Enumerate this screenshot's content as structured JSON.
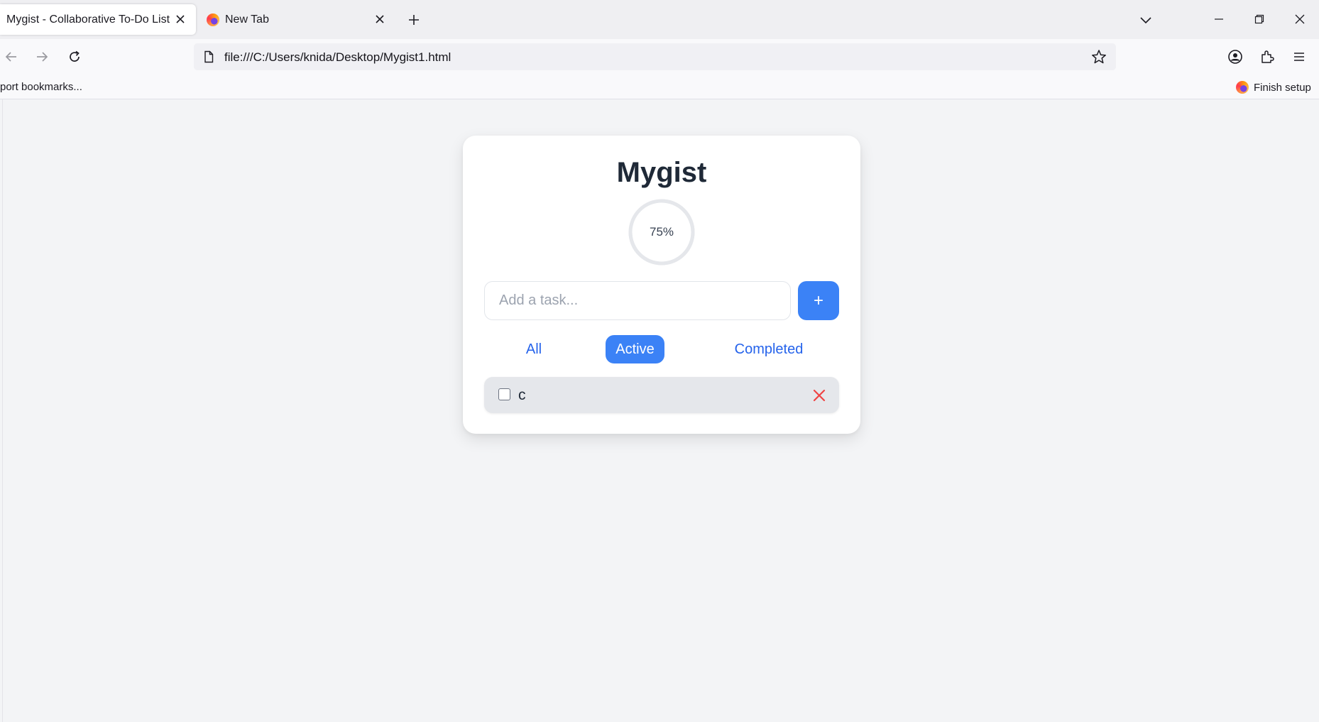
{
  "browser": {
    "tabs": [
      {
        "label": "Mygist - Collaborative To-Do List",
        "active": true,
        "icon": "page-icon"
      },
      {
        "label": "New Tab",
        "active": false,
        "icon": "firefox-icon"
      }
    ],
    "url": "file:///C:/Users/knida/Desktop/Mygist1.html",
    "bookmarks_left": "port bookmarks...",
    "bookmarks_right": "Finish setup"
  },
  "app": {
    "title": "Mygist",
    "progress": {
      "percent": 75,
      "label": "75%"
    },
    "input": {
      "placeholder": "Add a task...",
      "value": ""
    },
    "add_button_label": "+",
    "filters": [
      {
        "label": "All",
        "selected": false
      },
      {
        "label": "Active",
        "selected": true
      },
      {
        "label": "Completed",
        "selected": false
      }
    ],
    "tasks": [
      {
        "text": "c",
        "completed": false,
        "delete_icon": "close-x-icon"
      }
    ]
  },
  "colors": {
    "accent": "#3b82f6",
    "link": "#2563eb",
    "delete": "#ef4444",
    "page_bg": "#f3f4f6"
  }
}
